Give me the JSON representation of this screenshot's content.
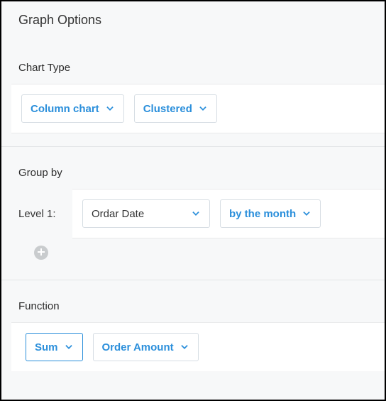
{
  "panel": {
    "title": "Graph Options"
  },
  "chartType": {
    "label": "Chart Type",
    "typeSelector": "Column chart",
    "layoutSelector": "Clustered"
  },
  "groupBy": {
    "label": "Group by",
    "levelLabel": "Level 1:",
    "field": "Ordar Date",
    "bucket": "by the month"
  },
  "function": {
    "label": "Function",
    "aggregate": "Sum",
    "target": "Order Amount"
  }
}
